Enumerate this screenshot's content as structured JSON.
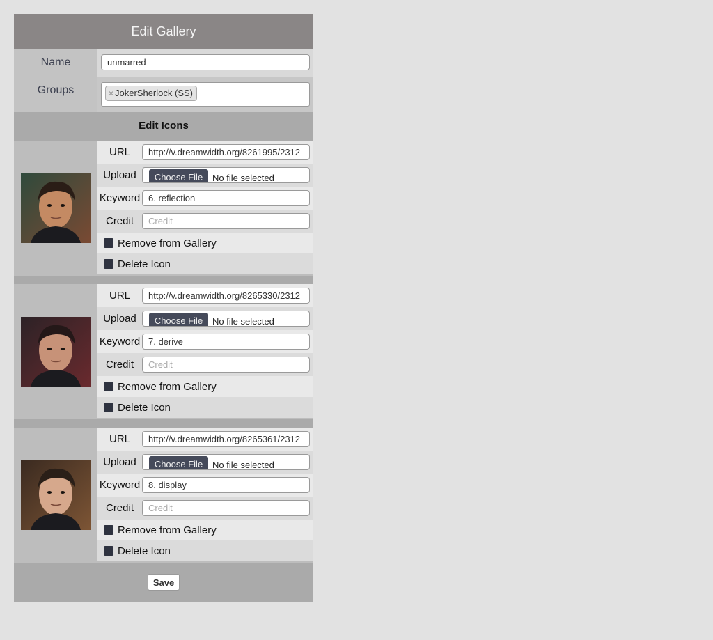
{
  "header": {
    "title": "Edit Gallery"
  },
  "gallery": {
    "name_label": "Name",
    "name_value": "unmarred",
    "groups_label": "Groups",
    "groups": [
      {
        "remove_glyph": "×",
        "label": "JokerSherlock (SS)"
      }
    ]
  },
  "icons_section": {
    "title": "Edit Icons"
  },
  "field_labels": {
    "url": "URL",
    "upload": "Upload",
    "keyword": "Keyword",
    "credit": "Credit",
    "choose_file": "Choose File",
    "no_file": "No file selected",
    "credit_placeholder": "Credit",
    "remove_from_gallery": "Remove from Gallery",
    "delete_icon": "Delete Icon"
  },
  "icons": [
    {
      "url": "http://v.dreamwidth.org/8261995/2312",
      "keyword": "6. reflection",
      "credit": "",
      "remove_checked": false,
      "delete_checked": false,
      "colors": {
        "bg1": "#2f4a3c",
        "bg2": "#7a4a33",
        "skin": "#c48a63",
        "hair": "#2a1d16"
      }
    },
    {
      "url": "http://v.dreamwidth.org/8265330/2312",
      "keyword": "7. derive",
      "credit": "",
      "remove_checked": false,
      "delete_checked": false,
      "colors": {
        "bg1": "#2c2226",
        "bg2": "#6a2a2e",
        "skin": "#c79278",
        "hair": "#241818"
      }
    },
    {
      "url": "http://v.dreamwidth.org/8265361/2312",
      "keyword": "8. display",
      "credit": "",
      "remove_checked": false,
      "delete_checked": false,
      "colors": {
        "bg1": "#3a2a20",
        "bg2": "#7d5535",
        "skin": "#d6a88c",
        "hair": "#2a1f18"
      }
    }
  ],
  "footer": {
    "save_label": "Save"
  }
}
